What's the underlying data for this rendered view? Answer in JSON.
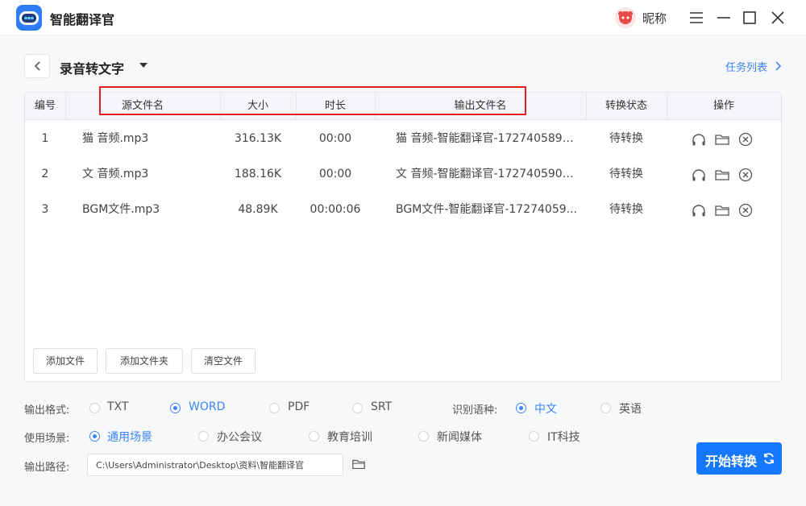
{
  "app": {
    "title": "智能翻译官",
    "nickname": "昵称"
  },
  "header": {
    "page_title": "录音转文字",
    "task_list": "任务列表"
  },
  "table": {
    "columns": [
      "编号",
      "源文件名",
      "大小",
      "时长",
      "输出文件名",
      "转换状态",
      "操作"
    ],
    "rows": [
      {
        "index": "1",
        "source": "猫 音频.mp3",
        "size": "316.13K",
        "duration": "00:00",
        "output": "猫 音频-智能翻译官-1727405899...",
        "status": "待转换"
      },
      {
        "index": "2",
        "source": "文 音频.mp3",
        "size": "188.16K",
        "duration": "00:00",
        "output": "文 音频-智能翻译官-1727405900...",
        "status": "待转换"
      },
      {
        "index": "3",
        "source": "BGM文件.mp3",
        "size": "48.89K",
        "duration": "00:00:06",
        "output": "BGM文件-智能翻译官-17274059...",
        "status": "待转换"
      }
    ]
  },
  "actions": {
    "add_file": "添加文件",
    "add_folder": "添加文件夹",
    "clear_files": "清空文件"
  },
  "options": {
    "format_label": "输出格式:",
    "formats": [
      "TXT",
      "WORD",
      "PDF",
      "SRT"
    ],
    "selected_format": "WORD",
    "language_label": "识别语种:",
    "languages": [
      "中文",
      "英语"
    ],
    "selected_language": "中文",
    "scene_label": "使用场景:",
    "scenes": [
      "通用场景",
      "办公会议",
      "教育培训",
      "新闻媒体",
      "IT科技"
    ],
    "selected_scene": "通用场景",
    "path_label": "输出路径:",
    "path_value": "C:\\Users\\Administrator\\Desktop\\资料\\智能翻译官"
  },
  "start_button": "开始转换",
  "colors": {
    "accent": "#1677ff",
    "link": "#3a84f5",
    "annotation": "#e02020"
  }
}
